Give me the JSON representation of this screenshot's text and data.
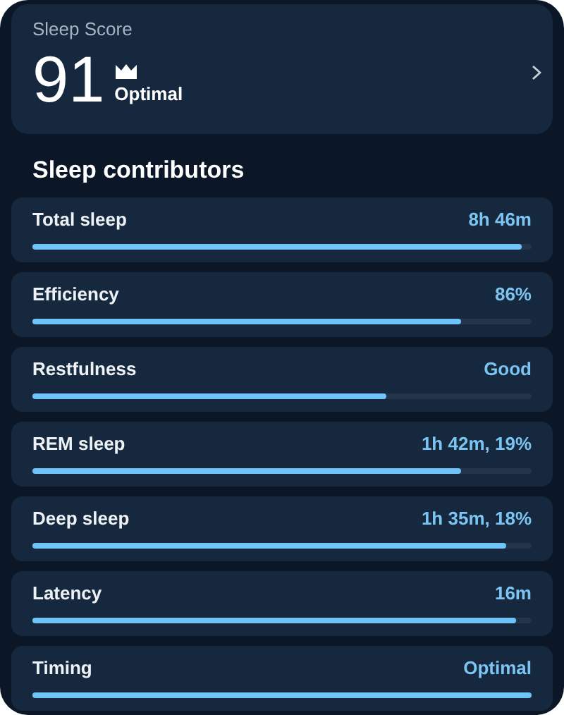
{
  "score_card": {
    "title": "Sleep Score",
    "score": "91",
    "rating": "Optimal"
  },
  "contributors_title": "Sleep contributors",
  "contributors": [
    {
      "name": "Total sleep",
      "reading": "8h 46m",
      "level": 0.98
    },
    {
      "name": "Efficiency",
      "reading": "86%",
      "level": 0.86
    },
    {
      "name": "Restfulness",
      "reading": "Good",
      "level": 0.71
    },
    {
      "name": "REM sleep",
      "reading": "1h 42m, 19%",
      "level": 0.86
    },
    {
      "name": "Deep sleep",
      "reading": "1h 35m, 18%",
      "level": 0.95
    },
    {
      "name": "Latency",
      "reading": "16m",
      "level": 0.97
    },
    {
      "name": "Timing",
      "reading": "Optimal",
      "level": 1.0
    }
  ]
}
